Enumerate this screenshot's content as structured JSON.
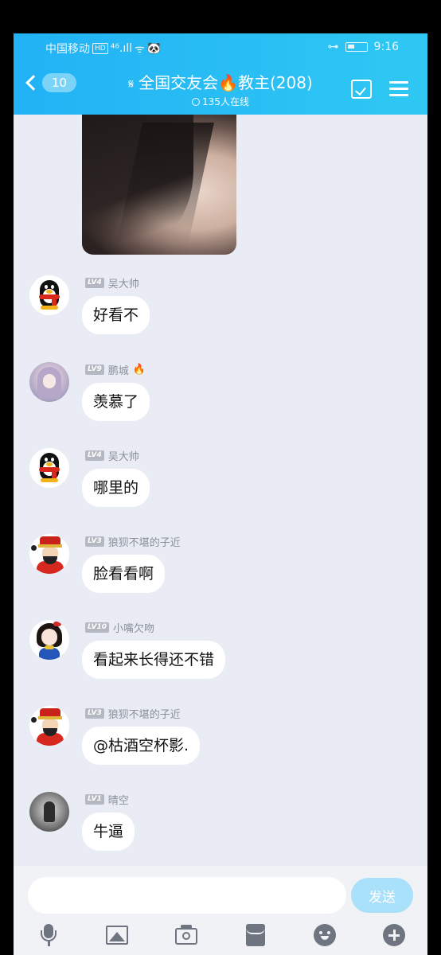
{
  "status_bar": {
    "carrier": "中国移动",
    "hd": "HD",
    "signal": "⁴⁶.ıll",
    "wifi": "ᯤ",
    "panda": "🐼",
    "key": "⊶",
    "time": "9:16"
  },
  "header": {
    "back_badge": "10",
    "title": "全国交友会🔥教主(208)",
    "online": "135人在线"
  },
  "messages": [
    {
      "level": "LV4",
      "name": "吴大帅",
      "extra": "",
      "text": "好看不",
      "avatar": "penguin"
    },
    {
      "level": "LV9",
      "name": "鹏城",
      "extra": "🔥",
      "text": "羡慕了",
      "avatar": "anime-girl"
    },
    {
      "level": "LV4",
      "name": "吴大帅",
      "extra": "",
      "text": "哪里的",
      "avatar": "penguin"
    },
    {
      "level": "LV3",
      "name": "狼狈不堪的子近",
      "extra": "",
      "text": "脸看看啊",
      "avatar": "god-of-wealth"
    },
    {
      "level": "LV10",
      "name": "小嘴欠吻",
      "extra": "",
      "text": "看起来长得还不错",
      "avatar": "cartoon-girl"
    },
    {
      "level": "LV3",
      "name": "狼狈不堪的子近",
      "extra": "",
      "text": "@枯酒空杯影.",
      "avatar": "god-of-wealth"
    },
    {
      "level": "LV1",
      "name": "晴空",
      "extra": "",
      "text": "牛逼",
      "avatar": "bw-photo"
    }
  ],
  "input": {
    "placeholder": "",
    "send_label": "发送"
  },
  "toolbar": [
    "mic-icon",
    "image-icon",
    "camera-icon",
    "red-packet-icon",
    "emoji-icon",
    "plus-icon"
  ],
  "colors": {
    "header": "#22b2f5",
    "chat_bg": "#e9ecf4",
    "send_disabled": "#a9e0fa"
  }
}
